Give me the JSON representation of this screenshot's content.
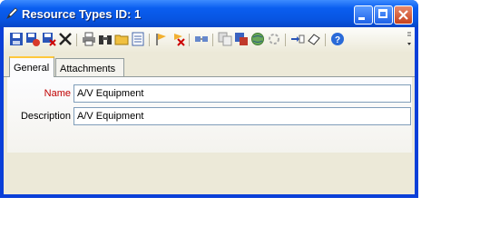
{
  "window": {
    "title": "Resource Types ID: 1"
  },
  "toolbar": {
    "icons": [
      "save-icon",
      "save-new-icon",
      "save-close-icon",
      "delete-icon",
      "print-icon",
      "find-icon",
      "open-folder-icon",
      "list-icon",
      "flag-icon",
      "flag-clear-icon",
      "link-icon",
      "copy-icon",
      "export-icon",
      "globe-icon",
      "refresh-icon",
      "transfer-icon",
      "attach-icon",
      "help-icon"
    ]
  },
  "tabs": [
    {
      "label": "General",
      "active": true
    },
    {
      "label": "Attachments",
      "active": false
    }
  ],
  "form": {
    "name_label": "Name",
    "name_value": "A/V Equipment",
    "description_label": "Description",
    "description_value": "A/V Equipment"
  },
  "colors": {
    "title_bar": "#0a5ef0",
    "required_label": "#c00000",
    "active_tab_highlight": "#ffc83c"
  }
}
